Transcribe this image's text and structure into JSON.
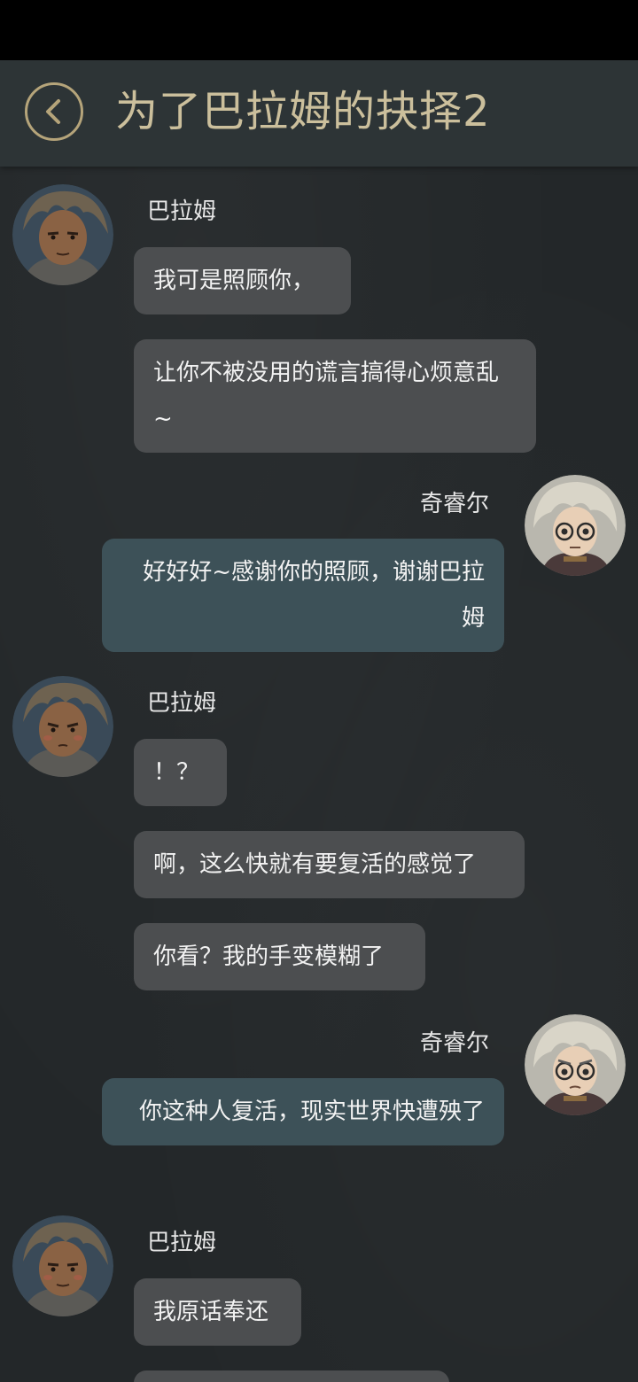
{
  "status_bar": {},
  "header": {
    "title": "为了巴拉姆的抉择2",
    "back_icon": "chevron-left-icon",
    "accent_color": "#b5a47a"
  },
  "characters": {
    "left": {
      "name": "巴拉姆",
      "avatar_icon": "balam-avatar"
    },
    "right": {
      "name": "奇睿尔",
      "avatar_icon": "qiruier-avatar"
    }
  },
  "messages": [
    {
      "side": "left",
      "sender": "巴拉姆",
      "bubbles": [
        "我可是照顾你，",
        "让你不被没用的谎言搞得心烦意乱~"
      ]
    },
    {
      "side": "right",
      "sender": "奇睿尔",
      "bubbles": [
        "好好好~感谢你的照顾，谢谢巴拉姆"
      ]
    },
    {
      "side": "left",
      "sender": "巴拉姆",
      "bubbles": [
        "！？",
        "啊，这么快就有要复活的感觉了",
        "你看？我的手变模糊了"
      ]
    },
    {
      "side": "right",
      "sender": "奇睿尔",
      "bubbles": [
        "你这种人复活，现实世界快遭殃了"
      ]
    },
    {
      "side": "left",
      "sender": "巴拉姆",
      "bubbles": [
        "我原话奉还",
        ""
      ]
    }
  ],
  "colors": {
    "left_bubble": "#4c4e50",
    "right_bubble": "#3d5158",
    "header_bg": "#2d3436",
    "title_color": "#cbbf9c"
  }
}
